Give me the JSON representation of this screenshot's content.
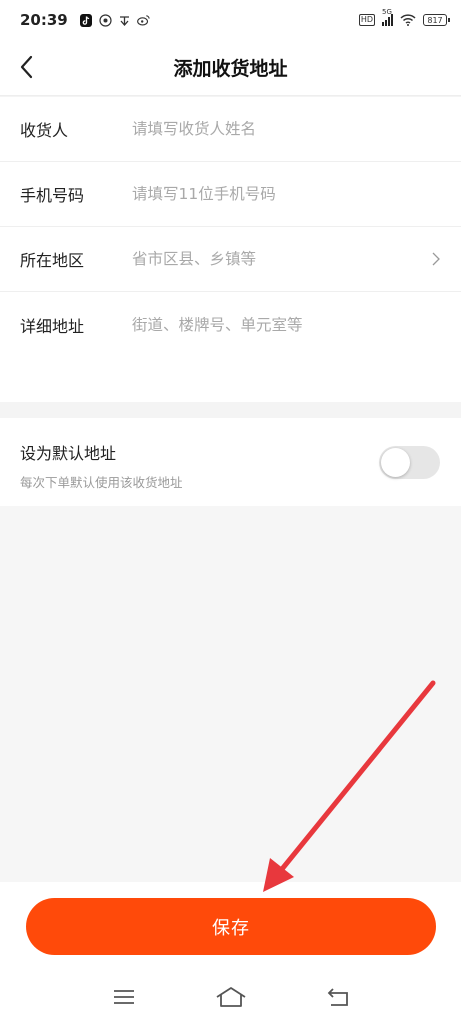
{
  "status_bar": {
    "time": "20:39",
    "app_icons": [
      "tiktok-icon",
      "app-icon",
      "app-icon",
      "weibo-icon"
    ],
    "hd_label": "HD",
    "network_label": "5G",
    "battery_label": "817"
  },
  "header": {
    "title": "添加收货地址"
  },
  "form": {
    "fields": [
      {
        "label": "收货人",
        "placeholder": "请填写收货人姓名",
        "value": ""
      },
      {
        "label": "手机号码",
        "placeholder": "请填写11位手机号码",
        "value": ""
      },
      {
        "label": "所在地区",
        "placeholder": "省市区县、乡镇等",
        "value": ""
      },
      {
        "label": "详细地址",
        "placeholder": "街道、楼牌号、单元室等",
        "value": ""
      }
    ]
  },
  "default_address": {
    "title": "设为默认地址",
    "subtitle": "每次下单默认使用该收货地址",
    "enabled": false
  },
  "actions": {
    "save_label": "保存"
  },
  "colors": {
    "accent": "#ff4a0a",
    "annotation": "#e8383d"
  },
  "nav_bar": {
    "icons": [
      "menu-icon",
      "home-icon",
      "back-icon"
    ]
  }
}
